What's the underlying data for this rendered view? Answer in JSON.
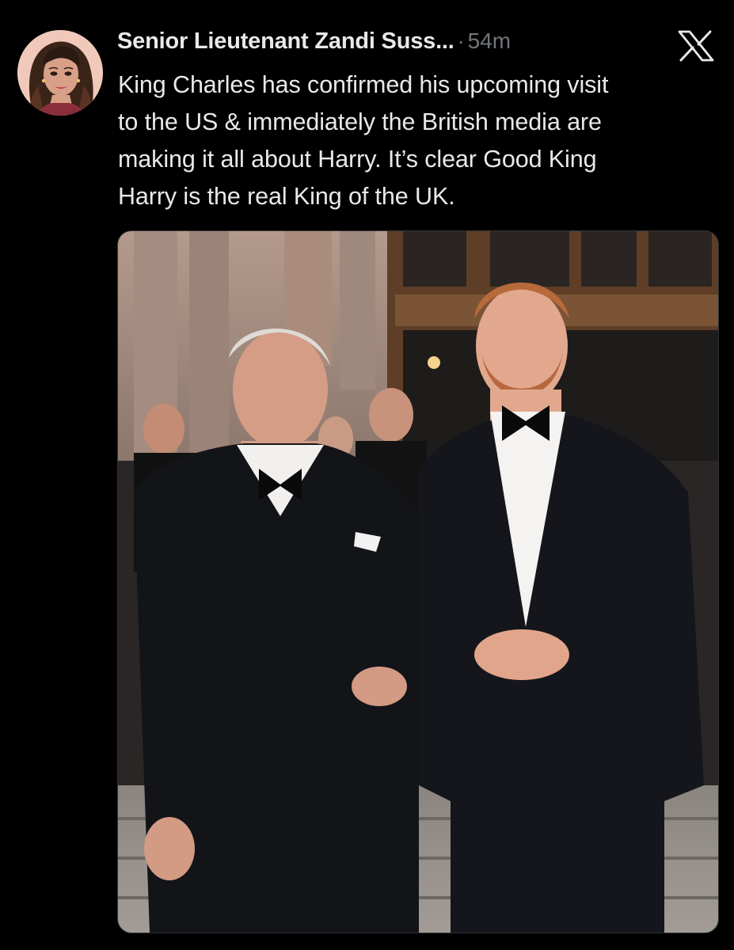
{
  "post": {
    "author": {
      "display_name": "Senior Lieutenant Zandi Suss...",
      "avatar_icon": "profile-avatar-illustration"
    },
    "separator": "·",
    "timestamp": "54m",
    "platform_icon": "x-logo-icon",
    "text_lines": [
      "King Charles has confirmed his upcoming visit",
      "to the US & immediately the British media are",
      "making it all about Harry. It’s clear Good King",
      "Harry is the real King of the UK."
    ],
    "media": {
      "kind": "photo",
      "subject": "two men in black tuxedos with bow ties standing in front of a stone building entrance"
    }
  },
  "colors": {
    "background": "#000000",
    "primary_text": "#e7e9ea",
    "secondary_text": "#71767b",
    "border": "#2f3336"
  }
}
